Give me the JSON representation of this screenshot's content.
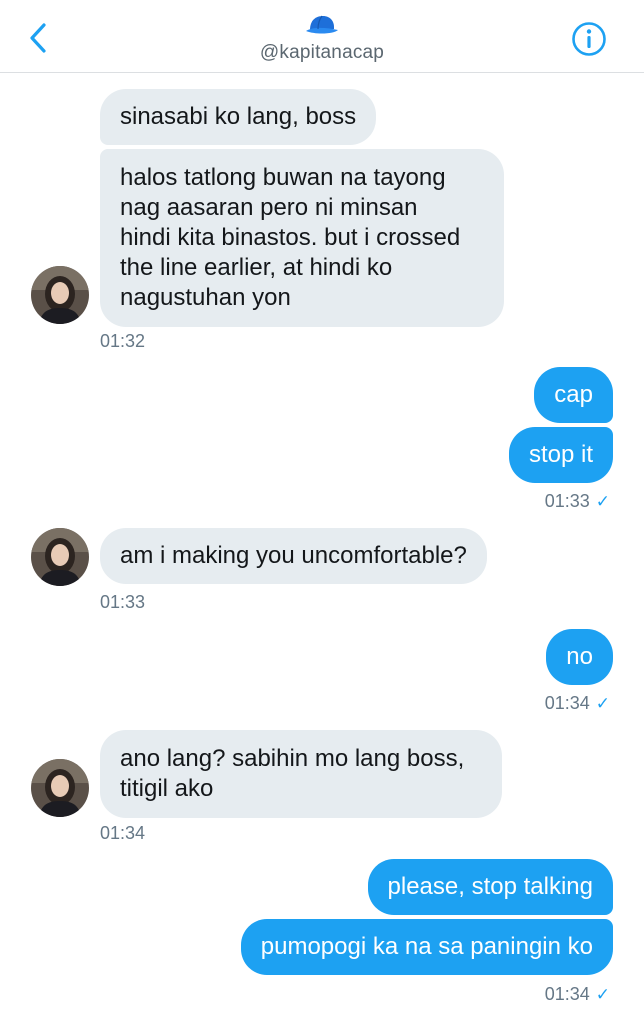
{
  "header": {
    "handle": "@kapitanacap",
    "back_icon": "chevron-left-icon",
    "info_icon": "info-circle-icon",
    "profile_icon": "baseball-cap-icon",
    "accent_color": "#1da1f2"
  },
  "messages": [
    {
      "id": "m1",
      "side": "in",
      "text": "sinasabi ko lang, boss"
    },
    {
      "id": "m2",
      "side": "in",
      "lines": [
        "halos tatlong buwan na tayong",
        "nag aasaran pero ni minsan",
        "hindi kita binastos. but i crossed",
        "the line earlier, at hindi ko",
        "nagustuhan yon"
      ]
    },
    {
      "id": "t1",
      "time": "01:32"
    },
    {
      "id": "m3",
      "side": "out",
      "text": "cap"
    },
    {
      "id": "m4",
      "side": "out",
      "text": "stop it"
    },
    {
      "id": "t2",
      "time": "01:33",
      "read": "✓"
    },
    {
      "id": "m5",
      "side": "in",
      "text": "am i making you uncomfortable?"
    },
    {
      "id": "t3",
      "time": "01:33"
    },
    {
      "id": "m6",
      "side": "out",
      "text": "no"
    },
    {
      "id": "t4",
      "time": "01:34",
      "read": "✓"
    },
    {
      "id": "m7",
      "side": "in",
      "lines": [
        "ano lang? sabihin mo lang boss,",
        "titigil ako"
      ]
    },
    {
      "id": "t5",
      "time": "01:34"
    },
    {
      "id": "m8",
      "side": "out",
      "text": "please, stop talking"
    },
    {
      "id": "m9",
      "side": "out",
      "text": "pumopogi ka na sa paningin ko"
    },
    {
      "id": "t6",
      "time": "01:34",
      "read": "✓"
    }
  ],
  "colors": {
    "incoming_bubble": "#e6ecf0",
    "outgoing_bubble": "#1da1f2",
    "timestamp": "#657786"
  }
}
